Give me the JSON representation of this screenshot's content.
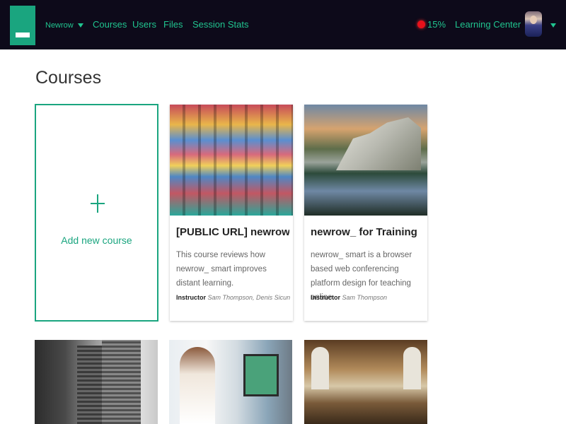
{
  "nav": {
    "brand_menu": "Newrow",
    "links": [
      "Courses",
      "Users",
      "Files",
      "Session Stats"
    ],
    "recording_percent": "15%",
    "learning_center": "Learning Center",
    "colors": {
      "background": "#0d0a1a",
      "accent": "#20c48f",
      "recording": "#e8111b"
    }
  },
  "page": {
    "title": "Courses"
  },
  "add_course": {
    "label": "Add new course",
    "icon": "plus-icon"
  },
  "courses": [
    {
      "title": "[PUBLIC URL] newrow_ sm...",
      "description": "This course reviews how newrow_ smart improves distant learning.",
      "instructor_label": "Instructor",
      "instructors": "Sam Thompson, Denis Sicun"
    },
    {
      "title": "newrow_ for Training",
      "description": "newrow_ smart is a browser based web conferencing platform design for teaching online.",
      "instructor_label": "Instructor",
      "instructors": "Sam Thompson"
    }
  ]
}
